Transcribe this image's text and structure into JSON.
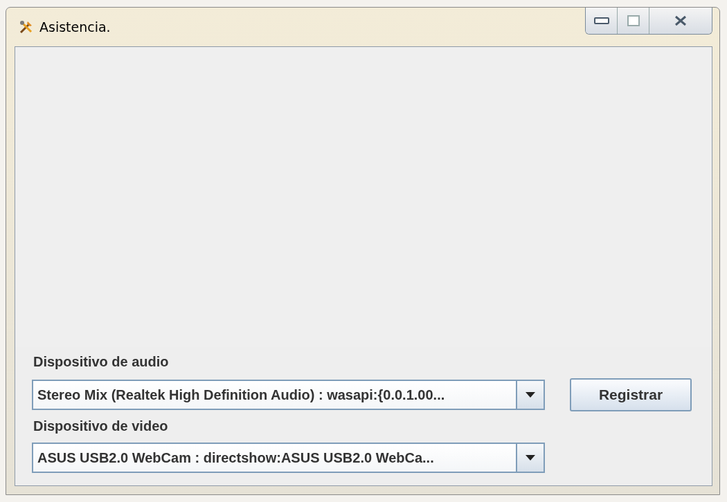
{
  "window": {
    "title": "Asistencia."
  },
  "audio": {
    "label": "Dispositivo de audio",
    "value": "Stereo Mix (Realtek High Definition Audio) : wasapi:{0.0.1.00..."
  },
  "register_button": "Registrar",
  "video": {
    "label": "Dispositivo de video",
    "value": "ASUS USB2.0 WebCam : directshow:ASUS USB2.0 WebCa..."
  }
}
